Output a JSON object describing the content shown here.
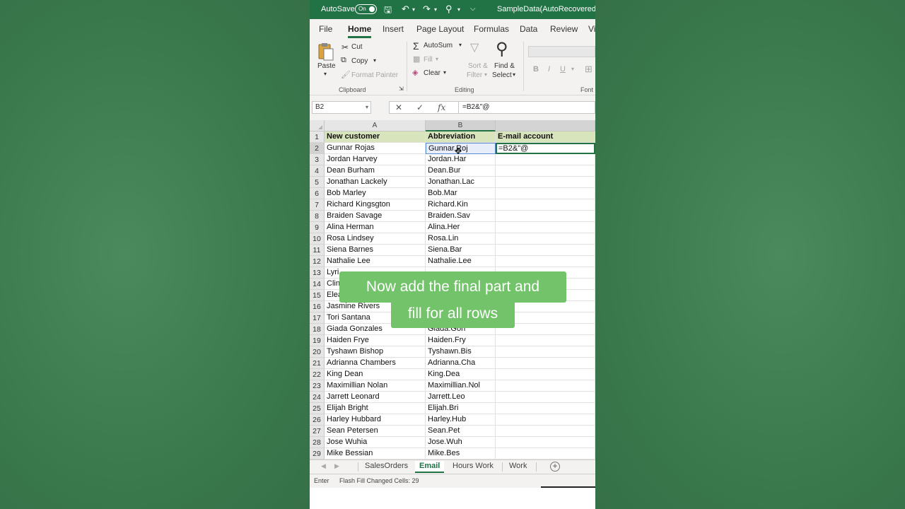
{
  "titlebar": {
    "autosave_label": "AutoSave",
    "autosave_state": "On",
    "document_title": "SampleData(AutoRecovered) •"
  },
  "ribbon_tabs": [
    "File",
    "Home",
    "Insert",
    "Page Layout",
    "Formulas",
    "Data",
    "Review",
    "Vi"
  ],
  "active_tab": "Home",
  "clipboard": {
    "paste": "Paste",
    "cut": "Cut",
    "copy": "Copy",
    "format_painter": "Format Painter",
    "group_label": "Clipboard"
  },
  "editing": {
    "autosum": "AutoSum",
    "fill": "Fill",
    "clear": "Clear",
    "sort_filter_1": "Sort &",
    "sort_filter_2": "Filter",
    "find_select_1": "Find &",
    "find_select_2": "Select",
    "group_label": "Editing"
  },
  "font": {
    "bold": "B",
    "italic": "I",
    "underline": "U",
    "group_label": "Font"
  },
  "formula_bar": {
    "name_box": "B2",
    "cancel_symbol": "✕",
    "enter_symbol": "✓",
    "fx_symbol": "fx",
    "formula": "=B2&\"@"
  },
  "columns": [
    "A",
    "B"
  ],
  "headers": [
    "New customer",
    "Abbreviation",
    "E-mail account"
  ],
  "rows": [
    {
      "n": "2",
      "a": "Gunnar Rojas",
      "b": "Gunnar.Roj",
      "c": "=B2&\"@"
    },
    {
      "n": "3",
      "a": "Jordan Harvey",
      "b": "Jordan.Har",
      "c": ""
    },
    {
      "n": "4",
      "a": "Dean Burham",
      "b": "Dean.Bur",
      "c": ""
    },
    {
      "n": "5",
      "a": "Jonathan Lackely",
      "b": "Jonathan.Lac",
      "c": ""
    },
    {
      "n": "6",
      "a": "Bob Marley",
      "b": "Bob.Mar",
      "c": ""
    },
    {
      "n": "7",
      "a": "Richard Kingsgton",
      "b": "Richard.Kin",
      "c": ""
    },
    {
      "n": "8",
      "a": "Braiden Savage",
      "b": "Braiden.Sav",
      "c": ""
    },
    {
      "n": "9",
      "a": "Alina Herman",
      "b": "Alina.Her",
      "c": ""
    },
    {
      "n": "10",
      "a": "Rosa Lindsey",
      "b": "Rosa.Lin",
      "c": ""
    },
    {
      "n": "11",
      "a": "Siena Barnes",
      "b": "Siena.Bar",
      "c": ""
    },
    {
      "n": "12",
      "a": "Nathalie Lee",
      "b": "Nathalie.Lee",
      "c": ""
    },
    {
      "n": "13",
      "a": "Lyri",
      "b": "",
      "c": ""
    },
    {
      "n": "14",
      "a": "Clin",
      "b": "",
      "c": ""
    },
    {
      "n": "15",
      "a": "Elea",
      "b": "",
      "c": ""
    },
    {
      "n": "16",
      "a": "Jasmine Rivers",
      "b": "",
      "c": ""
    },
    {
      "n": "17",
      "a": "Tori Santana",
      "b": "",
      "c": ""
    },
    {
      "n": "18",
      "a": "Giada Gonzales",
      "b": "Giada.Gon",
      "c": ""
    },
    {
      "n": "19",
      "a": "Haiden Frye",
      "b": "Haiden.Fry",
      "c": ""
    },
    {
      "n": "20",
      "a": "Tyshawn Bishop",
      "b": "Tyshawn.Bis",
      "c": ""
    },
    {
      "n": "21",
      "a": "Adrianna Chambers",
      "b": "Adrianna.Cha",
      "c": ""
    },
    {
      "n": "22",
      "a": "King Dean",
      "b": "King.Dea",
      "c": ""
    },
    {
      "n": "23",
      "a": "Maximillian Nolan",
      "b": "Maximillian.Nol",
      "c": ""
    },
    {
      "n": "24",
      "a": "Jarrett Leonard",
      "b": "Jarrett.Leo",
      "c": ""
    },
    {
      "n": "25",
      "a": "Elijah Bright",
      "b": "Elijah.Bri",
      "c": ""
    },
    {
      "n": "26",
      "a": "Harley Hubbard",
      "b": "Harley.Hub",
      "c": ""
    },
    {
      "n": "27",
      "a": "Sean Petersen",
      "b": "Sean.Pet",
      "c": ""
    },
    {
      "n": "28",
      "a": "Jose Wuhia",
      "b": "Jose.Wuh",
      "c": ""
    },
    {
      "n": "29",
      "a": "Mike Bessian",
      "b": "Mike.Bes",
      "c": ""
    }
  ],
  "caption": {
    "line1": "Now add the final part and",
    "line2": "fill for all rows"
  },
  "sheet_tabs": [
    "SalesOrders",
    "Email",
    "Hours Work",
    "Work"
  ],
  "active_sheet": "Email",
  "status": {
    "mode": "Enter",
    "message": "Flash Fill Changed Cells: 29"
  },
  "colors": {
    "excel_green": "#217346",
    "header_fill": "#d8e4bc",
    "caption_bg": "#72c36a",
    "background": "#3f7f52"
  }
}
